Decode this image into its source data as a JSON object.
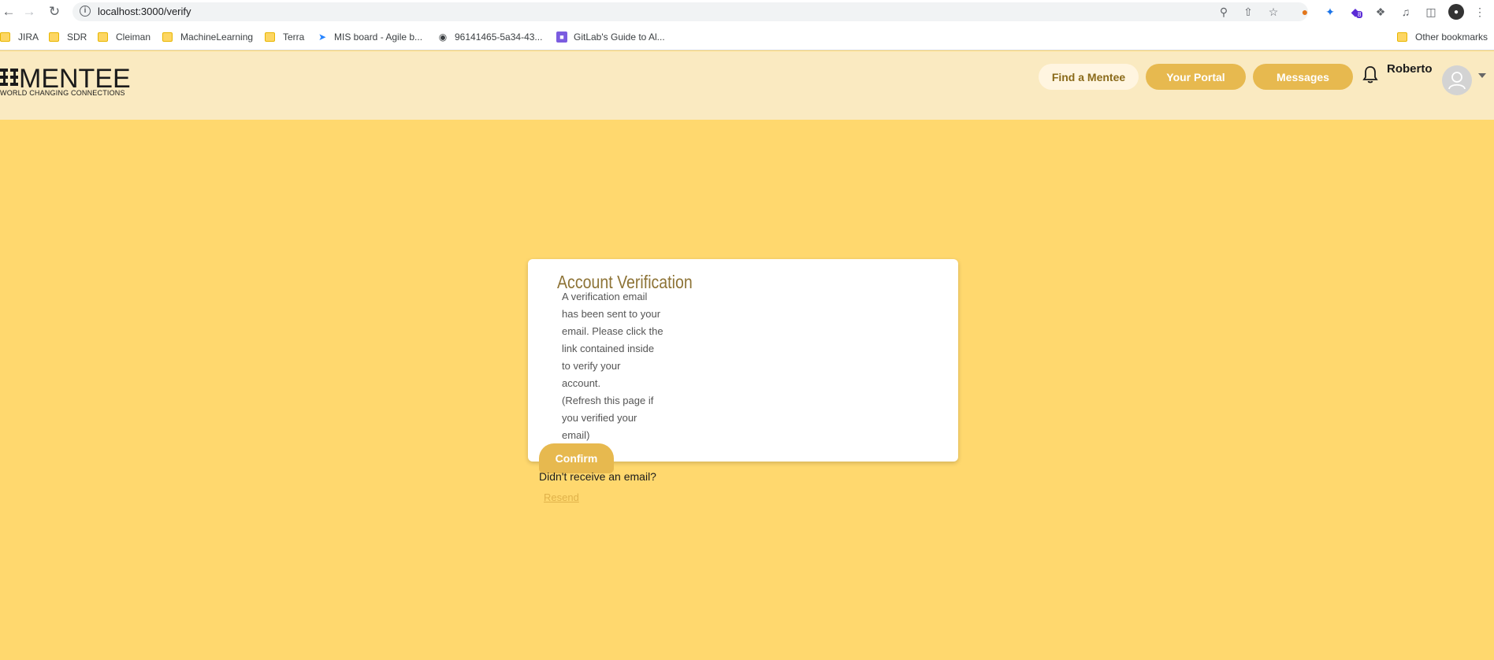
{
  "browser": {
    "url": "localhost:3000/verify",
    "bookmarks": [
      {
        "label": "JIRA",
        "icon": "folder-icon"
      },
      {
        "label": "SDR",
        "icon": "folder-icon"
      },
      {
        "label": "Cleiman",
        "icon": "folder-icon"
      },
      {
        "label": "MachineLearning",
        "icon": "folder-icon"
      },
      {
        "label": "Terra",
        "icon": "folder-icon"
      },
      {
        "label": "MIS board - Agile b...",
        "icon": "jira-icon"
      },
      {
        "label": "96141465-5a34-43...",
        "icon": "globe-icon"
      },
      {
        "label": "GitLab's Guide to Al...",
        "icon": "gitlab-icon"
      }
    ],
    "other_bookmarks": "Other bookmarks",
    "extension_badge": "8"
  },
  "header": {
    "logo_word": "MENTEE",
    "logo_tagline": "WORLD CHANGING CONNECTIONS",
    "find_mentee": "Find a Mentee",
    "your_portal": "Your Portal",
    "messages": "Messages",
    "username": "Roberto"
  },
  "card": {
    "title": "Account Verification",
    "body_lines": [
      "A verification email",
      "has been sent to your",
      "email. Please click the",
      "link contained inside",
      "to verify your",
      "account.",
      "(Refresh this page if",
      "you verified your",
      "email)"
    ],
    "confirm": "Confirm",
    "no_email": "Didn't receive an email?",
    "resend": "Resend"
  },
  "colors": {
    "page_bg": "#ffd86e",
    "header_bg": "#faeac1",
    "accent": "#e7b94f",
    "title": "#8d7336"
  }
}
